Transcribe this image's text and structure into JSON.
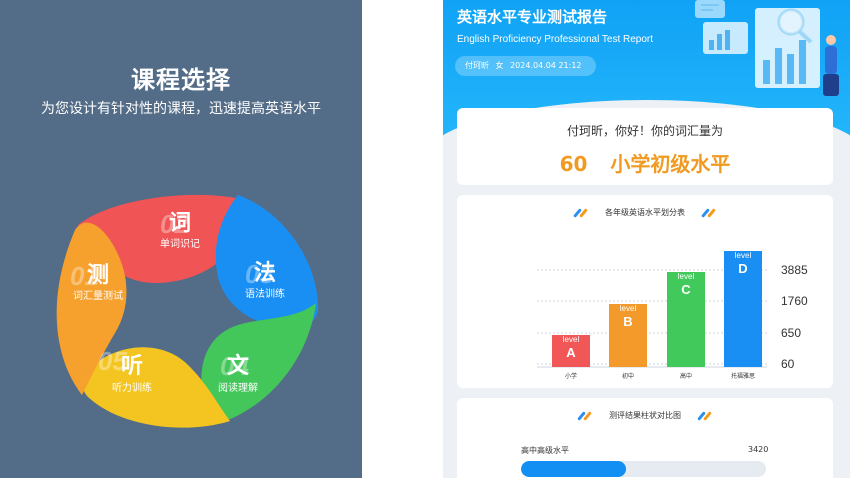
{
  "left": {
    "title": "课程选择",
    "subtitle": "为您设计有针对性的课程，迅速提高英语水平",
    "petals": [
      {
        "char": "词",
        "label": "单词识记",
        "num": "02",
        "color": "#f05454"
      },
      {
        "char": "法",
        "label": "语法训练",
        "num": "03",
        "color": "#1a8ff3"
      },
      {
        "char": "文",
        "label": "阅读理解",
        "num": "04",
        "color": "#43c65a"
      },
      {
        "char": "听",
        "label": "听力训练",
        "num": "05",
        "color": "#f4c520"
      },
      {
        "char": "测",
        "label": "词汇量测试",
        "num": "01",
        "color": "#f6a02e"
      }
    ]
  },
  "report": {
    "title": "英语水平专业测试报告",
    "subtitle": "English Proficiency Professional Test Report",
    "user_name": "付珂昕",
    "user_gender": "女",
    "user_time": "2024.04.04 21:12"
  },
  "result": {
    "greeting": "付珂昕，你好！你的词汇量为",
    "vocab": "60",
    "level_text": "小学初级水平"
  },
  "grade_chart": {
    "heading": "各年级英语水平划分表",
    "bar_top_label": "level",
    "chart_data": {
      "type": "bar",
      "title": "各年级英语水平划分表",
      "categories": [
        "小学",
        "初中",
        "高中",
        "托福雅思"
      ],
      "level_letters": [
        "A",
        "B",
        "C",
        "D"
      ],
      "values": [
        60,
        1760,
        3885,
        5000
      ],
      "colors": [
        "#f25757",
        "#f39a2a",
        "#42c95c",
        "#1a8ff3"
      ],
      "y_ticks": [
        "3885",
        "1760",
        "650",
        "60"
      ]
    }
  },
  "compare": {
    "heading": "测评结果柱状对比图",
    "row_label": "高中高级水平",
    "row_value": "3420",
    "row_fraction": 0.43
  }
}
